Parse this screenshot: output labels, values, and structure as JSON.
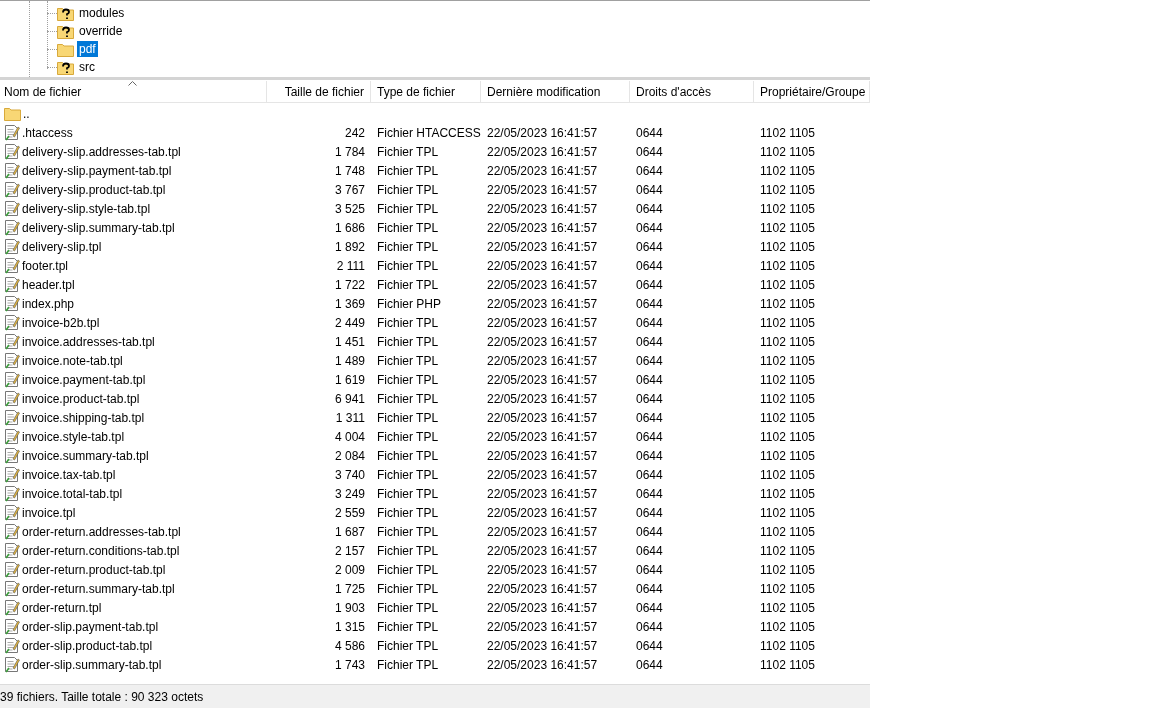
{
  "tree": {
    "items": [
      {
        "label": "modules",
        "kind": "unknown",
        "selected": false
      },
      {
        "label": "override",
        "kind": "unknown",
        "selected": false
      },
      {
        "label": "pdf",
        "kind": "folder",
        "selected": true
      },
      {
        "label": "src",
        "kind": "unknown",
        "selected": false
      }
    ]
  },
  "file_list": {
    "columns": [
      "Nom de fichier",
      "Taille de fichier",
      "Type de fichier",
      "Dernière modification",
      "Droits d'accès",
      "Propriétaire/Groupe"
    ],
    "rows": [
      {
        "kind": "parent",
        "name": ".."
      },
      {
        "kind": "file",
        "name": ".htaccess",
        "size": "242",
        "type": "Fichier HTACCESS",
        "modified": "22/05/2023 16:41:57",
        "rights": "0644",
        "owner": "1102 1105"
      },
      {
        "kind": "file",
        "name": "delivery-slip.addresses-tab.tpl",
        "size": "1 784",
        "type": "Fichier TPL",
        "modified": "22/05/2023 16:41:57",
        "rights": "0644",
        "owner": "1102 1105"
      },
      {
        "kind": "file",
        "name": "delivery-slip.payment-tab.tpl",
        "size": "1 748",
        "type": "Fichier TPL",
        "modified": "22/05/2023 16:41:57",
        "rights": "0644",
        "owner": "1102 1105"
      },
      {
        "kind": "file",
        "name": "delivery-slip.product-tab.tpl",
        "size": "3 767",
        "type": "Fichier TPL",
        "modified": "22/05/2023 16:41:57",
        "rights": "0644",
        "owner": "1102 1105"
      },
      {
        "kind": "file",
        "name": "delivery-slip.style-tab.tpl",
        "size": "3 525",
        "type": "Fichier TPL",
        "modified": "22/05/2023 16:41:57",
        "rights": "0644",
        "owner": "1102 1105"
      },
      {
        "kind": "file",
        "name": "delivery-slip.summary-tab.tpl",
        "size": "1 686",
        "type": "Fichier TPL",
        "modified": "22/05/2023 16:41:57",
        "rights": "0644",
        "owner": "1102 1105"
      },
      {
        "kind": "file",
        "name": "delivery-slip.tpl",
        "size": "1 892",
        "type": "Fichier TPL",
        "modified": "22/05/2023 16:41:57",
        "rights": "0644",
        "owner": "1102 1105"
      },
      {
        "kind": "file",
        "name": "footer.tpl",
        "size": "2 111",
        "type": "Fichier TPL",
        "modified": "22/05/2023 16:41:57",
        "rights": "0644",
        "owner": "1102 1105"
      },
      {
        "kind": "file",
        "name": "header.tpl",
        "size": "1 722",
        "type": "Fichier TPL",
        "modified": "22/05/2023 16:41:57",
        "rights": "0644",
        "owner": "1102 1105"
      },
      {
        "kind": "file",
        "name": "index.php",
        "size": "1 369",
        "type": "Fichier PHP",
        "modified": "22/05/2023 16:41:57",
        "rights": "0644",
        "owner": "1102 1105"
      },
      {
        "kind": "file",
        "name": "invoice-b2b.tpl",
        "size": "2 449",
        "type": "Fichier TPL",
        "modified": "22/05/2023 16:41:57",
        "rights": "0644",
        "owner": "1102 1105"
      },
      {
        "kind": "file",
        "name": "invoice.addresses-tab.tpl",
        "size": "1 451",
        "type": "Fichier TPL",
        "modified": "22/05/2023 16:41:57",
        "rights": "0644",
        "owner": "1102 1105"
      },
      {
        "kind": "file",
        "name": "invoice.note-tab.tpl",
        "size": "1 489",
        "type": "Fichier TPL",
        "modified": "22/05/2023 16:41:57",
        "rights": "0644",
        "owner": "1102 1105"
      },
      {
        "kind": "file",
        "name": "invoice.payment-tab.tpl",
        "size": "1 619",
        "type": "Fichier TPL",
        "modified": "22/05/2023 16:41:57",
        "rights": "0644",
        "owner": "1102 1105"
      },
      {
        "kind": "file",
        "name": "invoice.product-tab.tpl",
        "size": "6 941",
        "type": "Fichier TPL",
        "modified": "22/05/2023 16:41:57",
        "rights": "0644",
        "owner": "1102 1105"
      },
      {
        "kind": "file",
        "name": "invoice.shipping-tab.tpl",
        "size": "1 311",
        "type": "Fichier TPL",
        "modified": "22/05/2023 16:41:57",
        "rights": "0644",
        "owner": "1102 1105"
      },
      {
        "kind": "file",
        "name": "invoice.style-tab.tpl",
        "size": "4 004",
        "type": "Fichier TPL",
        "modified": "22/05/2023 16:41:57",
        "rights": "0644",
        "owner": "1102 1105"
      },
      {
        "kind": "file",
        "name": "invoice.summary-tab.tpl",
        "size": "2 084",
        "type": "Fichier TPL",
        "modified": "22/05/2023 16:41:57",
        "rights": "0644",
        "owner": "1102 1105"
      },
      {
        "kind": "file",
        "name": "invoice.tax-tab.tpl",
        "size": "3 740",
        "type": "Fichier TPL",
        "modified": "22/05/2023 16:41:57",
        "rights": "0644",
        "owner": "1102 1105"
      },
      {
        "kind": "file",
        "name": "invoice.total-tab.tpl",
        "size": "3 249",
        "type": "Fichier TPL",
        "modified": "22/05/2023 16:41:57",
        "rights": "0644",
        "owner": "1102 1105"
      },
      {
        "kind": "file",
        "name": "invoice.tpl",
        "size": "2 559",
        "type": "Fichier TPL",
        "modified": "22/05/2023 16:41:57",
        "rights": "0644",
        "owner": "1102 1105"
      },
      {
        "kind": "file",
        "name": "order-return.addresses-tab.tpl",
        "size": "1 687",
        "type": "Fichier TPL",
        "modified": "22/05/2023 16:41:57",
        "rights": "0644",
        "owner": "1102 1105"
      },
      {
        "kind": "file",
        "name": "order-return.conditions-tab.tpl",
        "size": "2 157",
        "type": "Fichier TPL",
        "modified": "22/05/2023 16:41:57",
        "rights": "0644",
        "owner": "1102 1105"
      },
      {
        "kind": "file",
        "name": "order-return.product-tab.tpl",
        "size": "2 009",
        "type": "Fichier TPL",
        "modified": "22/05/2023 16:41:57",
        "rights": "0644",
        "owner": "1102 1105"
      },
      {
        "kind": "file",
        "name": "order-return.summary-tab.tpl",
        "size": "1 725",
        "type": "Fichier TPL",
        "modified": "22/05/2023 16:41:57",
        "rights": "0644",
        "owner": "1102 1105"
      },
      {
        "kind": "file",
        "name": "order-return.tpl",
        "size": "1 903",
        "type": "Fichier TPL",
        "modified": "22/05/2023 16:41:57",
        "rights": "0644",
        "owner": "1102 1105"
      },
      {
        "kind": "file",
        "name": "order-slip.payment-tab.tpl",
        "size": "1 315",
        "type": "Fichier TPL",
        "modified": "22/05/2023 16:41:57",
        "rights": "0644",
        "owner": "1102 1105"
      },
      {
        "kind": "file",
        "name": "order-slip.product-tab.tpl",
        "size": "4 586",
        "type": "Fichier TPL",
        "modified": "22/05/2023 16:41:57",
        "rights": "0644",
        "owner": "1102 1105"
      },
      {
        "kind": "file",
        "name": "order-slip.summary-tab.tpl",
        "size": "1 743",
        "type": "Fichier TPL",
        "modified": "22/05/2023 16:41:57",
        "rights": "0644",
        "owner": "1102 1105"
      }
    ]
  },
  "status_bar": {
    "text": "39 fichiers. Taille totale : 90 323 octets"
  }
}
